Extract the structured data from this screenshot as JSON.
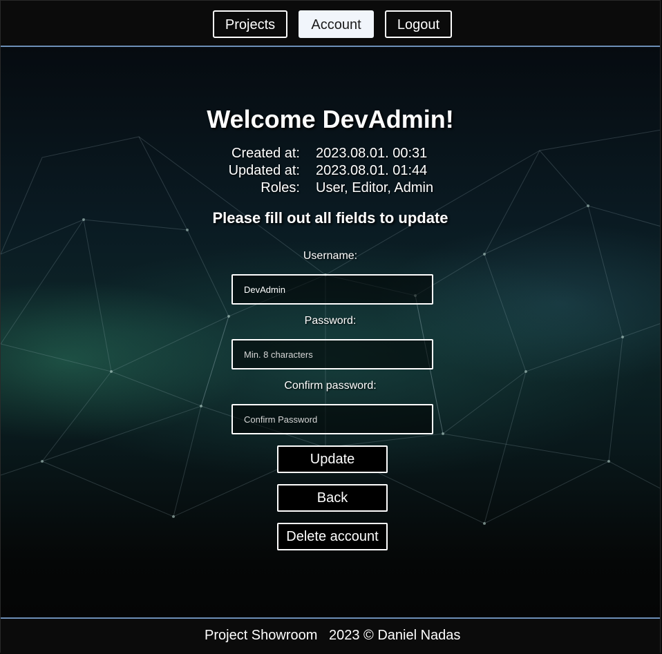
{
  "nav": {
    "projects_label": "Projects",
    "account_label": "Account",
    "logout_label": "Logout",
    "active": "Account"
  },
  "main": {
    "title": "Welcome DevAdmin!",
    "info": {
      "created_label": "Created at:",
      "created_value": "2023.08.01. 00:31",
      "updated_label": "Updated at:",
      "updated_value": "2023.08.01. 01:44",
      "roles_label": "Roles:",
      "roles_value": "User, Editor, Admin"
    },
    "subtitle": "Please fill out all fields to update",
    "form": {
      "username_label": "Username:",
      "username_value": "DevAdmin",
      "password_label": "Password:",
      "password_placeholder": "Min. 8 characters",
      "confirm_label": "Confirm password:",
      "confirm_placeholder": "Confirm Password"
    },
    "buttons": {
      "update_label": "Update",
      "back_label": "Back",
      "delete_label": "Delete account"
    }
  },
  "footer": {
    "site_name": "Project Showroom",
    "copyright": "2023 © Daniel Nadas"
  },
  "colors": {
    "accent_line": "#6d8fb8",
    "background": "#0a0a0a",
    "active_tab_bg": "#f1f5fb"
  }
}
